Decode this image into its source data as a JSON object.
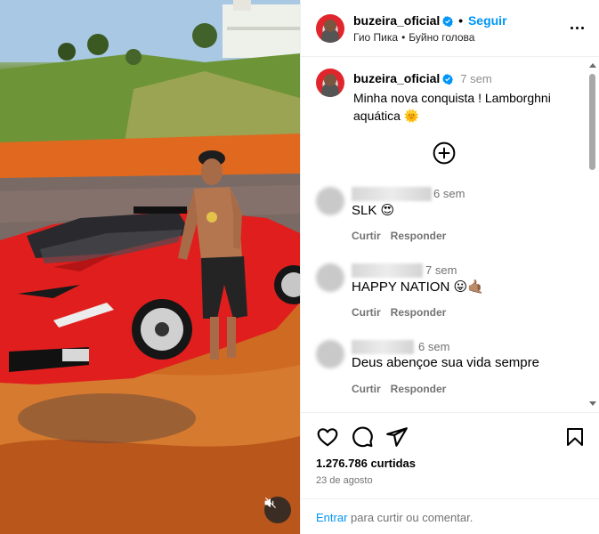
{
  "post": {
    "username": "buzeira_oficial",
    "follow_label": "Seguir",
    "audio_artist": "Гио Пика",
    "audio_title": "Буйно голова",
    "caption": {
      "username": "buzeira_oficial",
      "time": "7 sem",
      "text": "Minha nova conquista ! Lamborghni aquática 🌞"
    },
    "likes": "1.276.786 curtidas",
    "date": "23 de agosto"
  },
  "comments": [
    {
      "time": "6 sem",
      "text": "SLK 😍",
      "reply_label": "Responder",
      "like_label": "Curtir"
    },
    {
      "time": "7 sem",
      "text": "HAPPY NATION 😛🤙🏽",
      "reply_label": "Responder",
      "like_label": "Curtir"
    },
    {
      "time": "6 sem",
      "text": "Deus abençoe sua vida sempre",
      "reply_label": "Responder",
      "like_label": "Curtir"
    }
  ],
  "footer": {
    "login_link": "Entrar",
    "rest": "para curtir ou comentar."
  },
  "icons": {
    "more": "more-options-icon",
    "add": "add-comment-icon",
    "like": "heart-icon",
    "comment": "comment-icon",
    "share": "share-icon",
    "save": "bookmark-icon",
    "mute": "muted-speaker-icon",
    "verified": "verified-badge-icon"
  },
  "colors": {
    "accent": "#0095f6",
    "verified": "#0095f6",
    "car_red": "#e02020",
    "muted_text": "#737373"
  }
}
